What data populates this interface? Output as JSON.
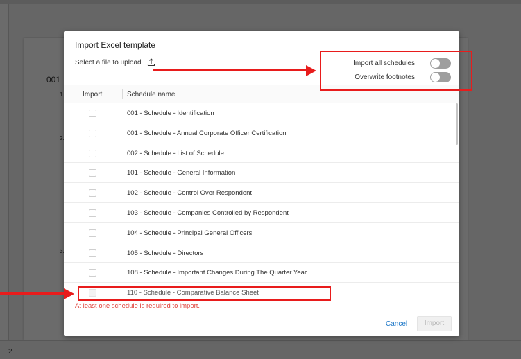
{
  "background": {
    "section_number": "001",
    "list_markers": [
      "1.",
      "2.",
      "3."
    ],
    "footer_page": "2"
  },
  "modal": {
    "title": "Import Excel template",
    "upload_label": "Select a file to upload",
    "toggles": [
      {
        "label": "Import all schedules",
        "state": "off"
      },
      {
        "label": "Overwrite footnotes",
        "state": "off"
      }
    ],
    "columns": {
      "import": "Import",
      "name": "Schedule name"
    },
    "schedules": [
      {
        "name": "001 - Schedule - Identification"
      },
      {
        "name": "001 - Schedule - Annual Corporate Officer Certification"
      },
      {
        "name": "002 - Schedule - List of Schedule"
      },
      {
        "name": "101 - Schedule - General Information"
      },
      {
        "name": "102 - Schedule - Control Over Respondent"
      },
      {
        "name": "103 - Schedule - Companies Controlled by Respondent"
      },
      {
        "name": "104 - Schedule - Principal General Officers"
      },
      {
        "name": "105 - Schedule - Directors"
      },
      {
        "name": "108 - Schedule - Important Changes During The Quarter Year"
      },
      {
        "name": "110 - Schedule - Comparative Balance Sheet"
      }
    ],
    "error": "At least one schedule is required to import.",
    "cancel_label": "Cancel",
    "import_label": "Import"
  },
  "colors": {
    "accent": "#1e78c8",
    "error": "#e0423b",
    "annotation": "#e81c1c"
  }
}
